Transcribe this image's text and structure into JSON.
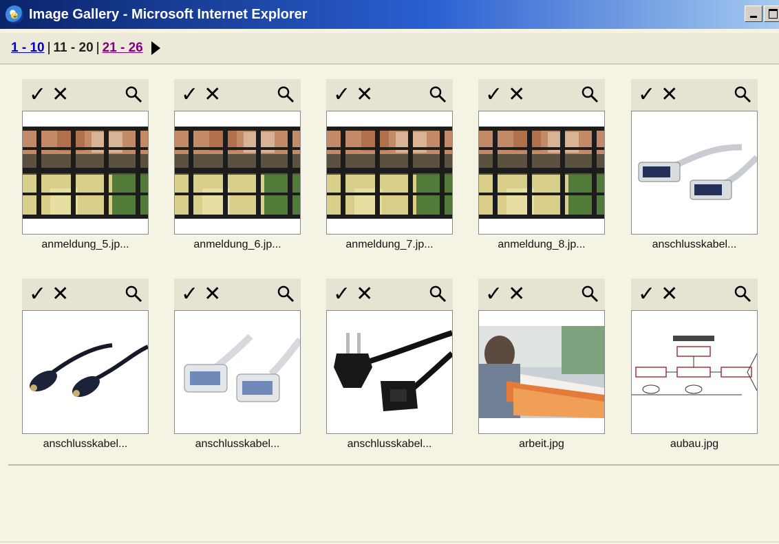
{
  "window": {
    "title": "Image Gallery - Microsoft Internet Explorer"
  },
  "pagination": {
    "first": "1 - 10",
    "current": "11 - 20",
    "last": "21 - 26",
    "separator": "|"
  },
  "items": [
    {
      "caption": "anmeldung_5.jp...",
      "thumb": "window-photo"
    },
    {
      "caption": "anmeldung_6.jp...",
      "thumb": "window-photo"
    },
    {
      "caption": "anmeldung_7.jp...",
      "thumb": "window-photo"
    },
    {
      "caption": "anmeldung_8.jp...",
      "thumb": "window-photo"
    },
    {
      "caption": "anschlusskabel...",
      "thumb": "parallel-cable"
    },
    {
      "caption": "anschlusskabel...",
      "thumb": "ps2-cable"
    },
    {
      "caption": "anschlusskabel...",
      "thumb": "serial-cable"
    },
    {
      "caption": "anschlusskabel...",
      "thumb": "power-cable"
    },
    {
      "caption": "arbeit.jpg",
      "thumb": "office-photo"
    },
    {
      "caption": "aubau.jpg",
      "thumb": "diagram"
    }
  ],
  "toolbar_icons": {
    "select": "checkmark-icon",
    "delete": "x-icon",
    "preview": "magnifier-icon"
  }
}
